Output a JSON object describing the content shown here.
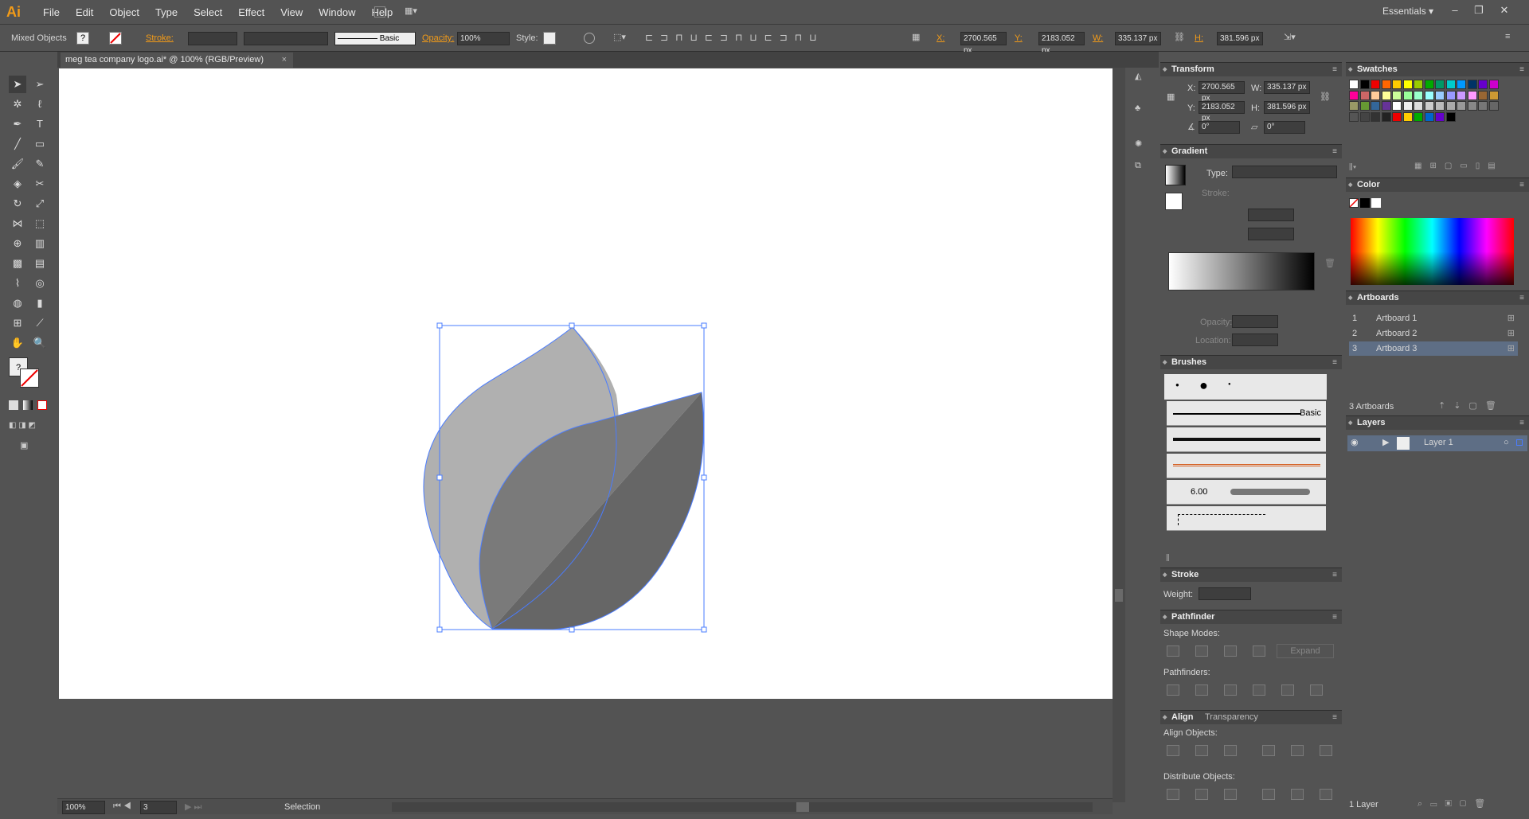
{
  "app": {
    "logo": "Ai",
    "workspace": "Essentials"
  },
  "menu": [
    "File",
    "Edit",
    "Object",
    "Type",
    "Select",
    "Effect",
    "View",
    "Window",
    "Help"
  ],
  "control": {
    "selection": "Mixed Objects",
    "stroke_label": "Stroke:",
    "brush_label": "Basic",
    "opacity_label": "Opacity:",
    "opacity_value": "100%",
    "style_label": "Style:",
    "x_label": "X:",
    "x_value": "2700.565 px",
    "y_label": "Y:",
    "y_value": "2183.052 px",
    "w_label": "W:",
    "w_value": "335.137 px",
    "h_label": "H:",
    "h_value": "381.596 px"
  },
  "document": {
    "tab_title": "meg tea company logo.ai* @ 100% (RGB/Preview)",
    "close": "×"
  },
  "status": {
    "zoom": "100%",
    "artboard_num": "3",
    "tool": "Selection"
  },
  "transform": {
    "title": "Transform",
    "x_label": "X:",
    "x": "2700.565 px",
    "y_label": "Y:",
    "y": "2183.052 px",
    "w_label": "W:",
    "w": "335.137 px",
    "h_label": "H:",
    "h": "381.596 px",
    "angle": "0°",
    "shear": "0°"
  },
  "gradient": {
    "title": "Gradient",
    "type_label": "Type:",
    "stroke_label": "Stroke:",
    "opacity_label": "Opacity:",
    "location_label": "Location:"
  },
  "brushes": {
    "title": "Brushes",
    "basic": "Basic",
    "size": "6.00"
  },
  "stroke": {
    "title": "Stroke",
    "weight_label": "Weight:"
  },
  "pathfinder": {
    "title": "Pathfinder",
    "shape_modes": "Shape Modes:",
    "expand": "Expand",
    "pathfinders": "Pathfinders:"
  },
  "align": {
    "title": "Align",
    "tab2": "Transparency",
    "align_objects": "Align Objects:",
    "distribute_objects": "Distribute Objects:"
  },
  "swatches": {
    "title": "Swatches"
  },
  "color": {
    "title": "Color"
  },
  "artboards": {
    "title": "Artboards",
    "items": [
      {
        "num": "1",
        "name": "Artboard 1"
      },
      {
        "num": "2",
        "name": "Artboard 2"
      },
      {
        "num": "3",
        "name": "Artboard 3"
      }
    ],
    "count": "3 Artboards"
  },
  "layers": {
    "title": "Layers",
    "items": [
      {
        "name": "Layer 1"
      }
    ],
    "count": "1 Layer"
  },
  "colors": {
    "accent": "#f29b18",
    "selection": "#4a7cff",
    "leaf_light": "#b0b0b0",
    "leaf_mid": "#7a7a7a",
    "leaf_dark": "#666666"
  }
}
